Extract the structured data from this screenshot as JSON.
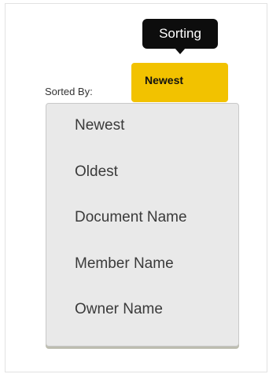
{
  "tooltip": {
    "text": "Sorting"
  },
  "sort": {
    "label": "Sorted By:",
    "selected": "Newest",
    "accent_color": "#f2c200"
  },
  "dropdown": {
    "options": [
      {
        "label": "Newest"
      },
      {
        "label": "Oldest"
      },
      {
        "label": "Document Name"
      },
      {
        "label": "Member Name"
      },
      {
        "label": "Owner Name"
      }
    ]
  }
}
